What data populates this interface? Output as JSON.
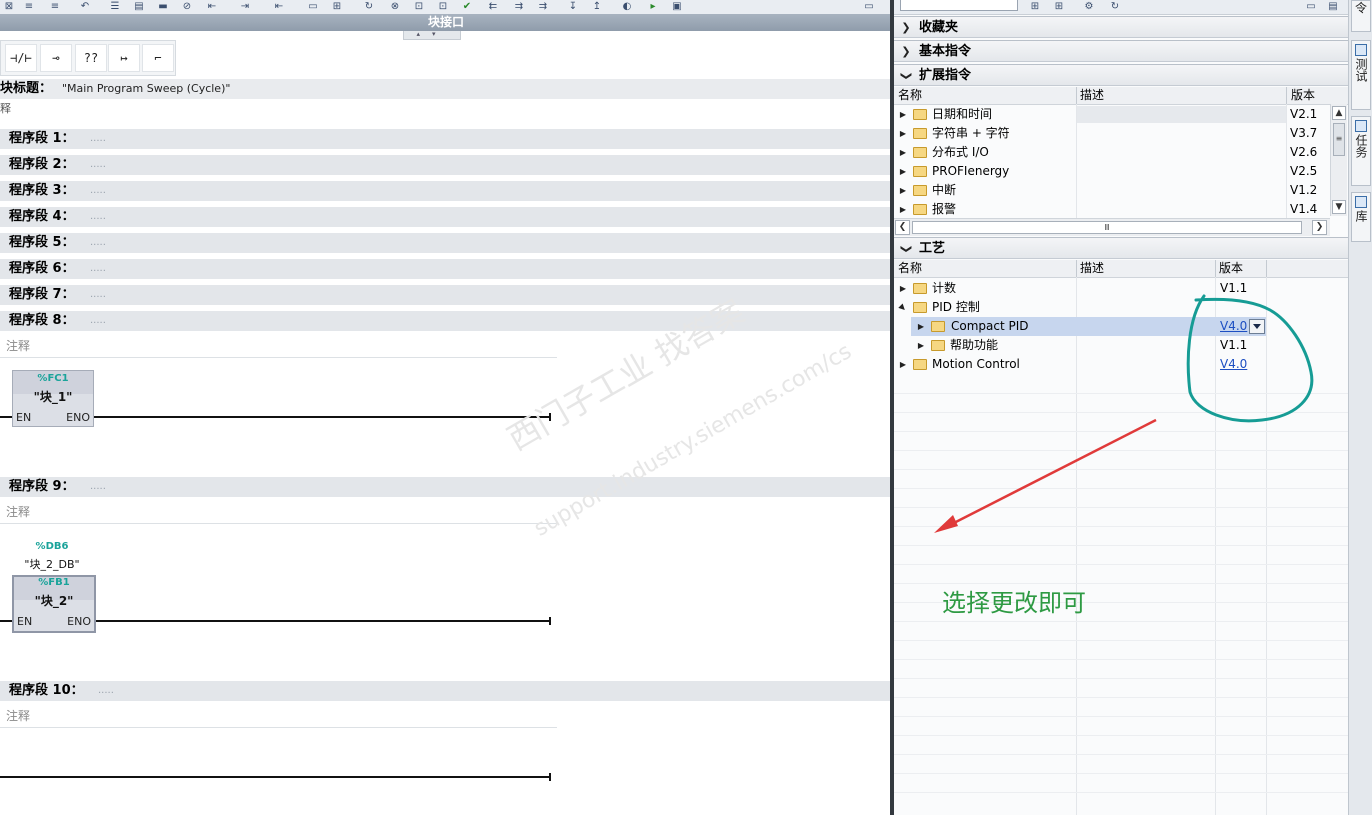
{
  "editor": {
    "interface_label": "块接口",
    "block_title_label": "块标题：",
    "block_title_value": "\"Main Program Sweep (Cycle)\"",
    "block_comment": "释",
    "lad_buttons": [
      "⊣/⊢",
      "⊸",
      "??",
      "↦",
      "⌐"
    ],
    "dots": ".....",
    "networks": [
      {
        "label": "程序段 1："
      },
      {
        "label": "程序段 2："
      },
      {
        "label": "程序段 3："
      },
      {
        "label": "程序段 4："
      },
      {
        "label": "程序段 5："
      },
      {
        "label": "程序段 6："
      },
      {
        "label": "程序段 7："
      },
      {
        "label": "程序段 8："
      },
      {
        "label": "程序段 9："
      },
      {
        "label": "程序段 10："
      }
    ],
    "comment_placeholder": "注释",
    "fc_block": {
      "address": "%FC1",
      "name": "\"块_1\"",
      "en": "EN",
      "eno": "ENO"
    },
    "fb_block": {
      "db_address": "%DB6",
      "db_name": "\"块_2_DB\"",
      "address": "%FB1",
      "name": "\"块_2\"",
      "en": "EN",
      "eno": "ENO"
    }
  },
  "panel": {
    "sections": {
      "favorites": "收藏夹",
      "basic": "基本指令",
      "extended": "扩展指令",
      "technology": "工艺"
    },
    "columns": {
      "name": "名称",
      "desc": "描述",
      "version": "版本"
    },
    "extended_items": [
      {
        "name": "日期和时间",
        "version": "V2.1"
      },
      {
        "name": "字符串 + 字符",
        "version": "V3.7"
      },
      {
        "name": "分布式 I/O",
        "version": "V2.6"
      },
      {
        "name": "PROFIenergy",
        "version": "V2.5"
      },
      {
        "name": "中断",
        "version": "V1.2"
      },
      {
        "name": "报警",
        "version": "V1.4"
      }
    ],
    "tech_items": [
      {
        "name": "计数",
        "version": "V1.1"
      },
      {
        "name": "PID 控制",
        "version": ""
      },
      {
        "name": "Compact PID",
        "version": "V4.0"
      },
      {
        "name": "帮助功能",
        "version": "V1.1"
      },
      {
        "name": "Motion Control",
        "version": "V4.0"
      }
    ]
  },
  "side_tabs": [
    "令",
    "测试",
    "任务",
    "库"
  ],
  "annotation": {
    "text": "选择更改即可",
    "color": "#2e9a43",
    "arrow_color": "#e03a3a",
    "circle_color": "#169c95"
  },
  "watermark": {
    "line1": "西门子工业  找答案",
    "line2": "support.industry.siemens.com/cs"
  },
  "colors": {
    "highlight_row": "#c7d6ee",
    "link": "#1d4fc2",
    "teal_address": "#1aa39a"
  }
}
